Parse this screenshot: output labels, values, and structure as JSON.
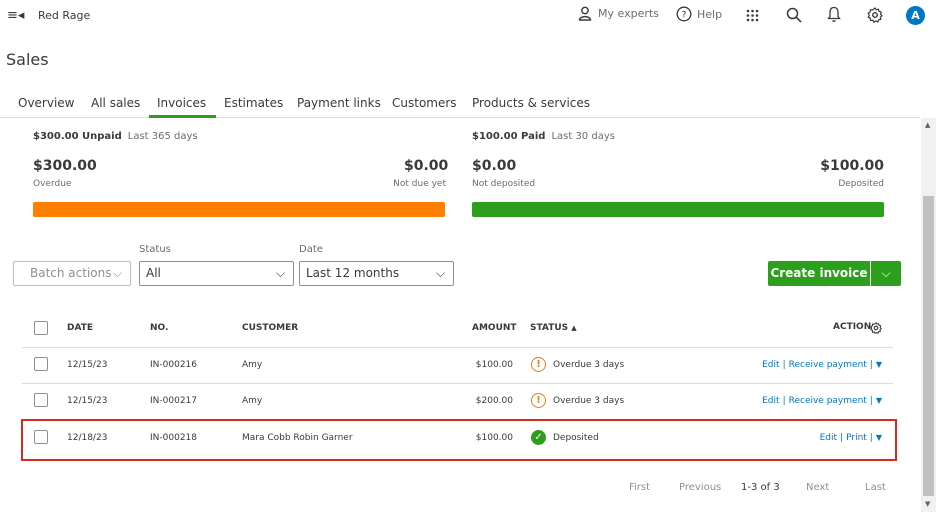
{
  "topbar": {
    "menu_icon": "hamburger-collapse-icon",
    "company": "Red Rage",
    "my_experts": "My experts",
    "help": "Help",
    "avatar_letter": "A"
  },
  "page": {
    "title": "Sales"
  },
  "tabs": [
    {
      "label": "Overview",
      "active": false
    },
    {
      "label": "All sales",
      "active": false
    },
    {
      "label": "Invoices",
      "active": true
    },
    {
      "label": "Estimates",
      "active": false
    },
    {
      "label": "Payment links",
      "active": false
    },
    {
      "label": "Customers",
      "active": false
    },
    {
      "label": "Products & services",
      "active": false
    }
  ],
  "summary": {
    "unpaid": {
      "amount_label": "$300.00 Unpaid",
      "period": "Last 365 days",
      "overdue_amount": "$300.00",
      "overdue_label": "Overdue",
      "notdue_amount": "$0.00",
      "notdue_label": "Not due yet",
      "overdue_fraction": 1.0
    },
    "paid": {
      "amount_label": "$100.00 Paid",
      "period": "Last 30 days",
      "not_deposited_amount": "$0.00",
      "not_deposited_label": "Not deposited",
      "deposited_amount": "$100.00",
      "deposited_label": "Deposited",
      "deposited_fraction": 1.0
    }
  },
  "filters": {
    "batch_actions": "Batch actions",
    "status_label": "Status",
    "status_value": "All",
    "date_label": "Date",
    "date_value": "Last 12 months"
  },
  "create_invoice": "Create invoice",
  "table": {
    "headers": {
      "date": "DATE",
      "no": "NO.",
      "customer": "CUSTOMER",
      "amount": "AMOUNT",
      "status": "STATUS",
      "status_sort": "▲",
      "action": "ACTION"
    },
    "rows": [
      {
        "date": "12/15/23",
        "no": "IN-000216",
        "customer": "Amy",
        "amount": "$100.00",
        "status": "Overdue 3 days",
        "status_type": "warning",
        "action1": "Edit",
        "action2": "Receive payment"
      },
      {
        "date": "12/15/23",
        "no": "IN-000217",
        "customer": "Amy",
        "amount": "$200.00",
        "status": "Overdue 3 days",
        "status_type": "warning",
        "action1": "Edit",
        "action2": "Receive payment"
      },
      {
        "date": "12/18/23",
        "no": "IN-000218",
        "customer": "Mara Cobb Robin Garner",
        "amount": "$100.00",
        "status": "Deposited",
        "status_type": "success",
        "action1": "Edit",
        "action2": "Print"
      }
    ]
  },
  "pagination": {
    "first": "First",
    "previous": "Previous",
    "range": "1-3 of 3",
    "next": "Next",
    "last": "Last"
  },
  "colors": {
    "accent_green": "#2ca01c",
    "overdue_orange": "#ff8000",
    "link_blue": "#0077c5",
    "highlight_red": "#d52b1e"
  }
}
